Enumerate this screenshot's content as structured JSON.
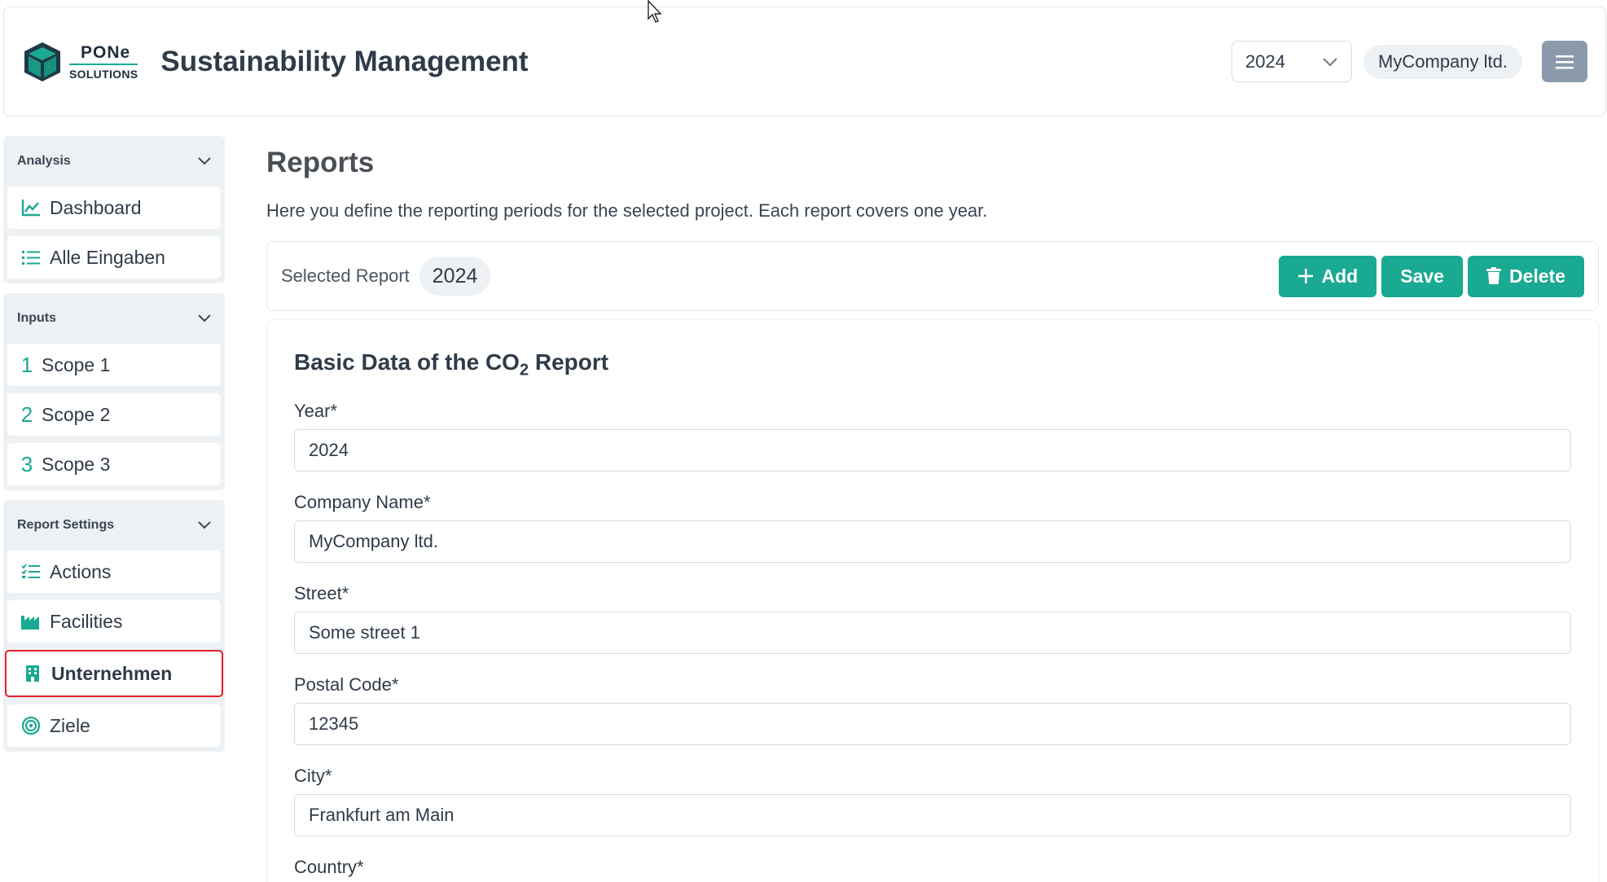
{
  "header": {
    "logo_top": "PONe",
    "logo_bottom": "SOLUTIONS",
    "title": "Sustainability Management",
    "year": "2024",
    "company": "MyCompany ltd."
  },
  "sidebar": {
    "groups": [
      {
        "title": "Analysis",
        "items": [
          {
            "label": "Dashboard",
            "icon": "chart-line-icon"
          },
          {
            "label": "Alle Eingaben",
            "icon": "list-icon"
          }
        ]
      },
      {
        "title": "Inputs",
        "items": [
          {
            "num": "1",
            "label": "Scope 1"
          },
          {
            "num": "2",
            "label": "Scope 2"
          },
          {
            "num": "3",
            "label": "Scope 3"
          }
        ]
      },
      {
        "title": "Report Settings",
        "items": [
          {
            "label": "Actions",
            "icon": "checklist-icon"
          },
          {
            "label": "Facilities",
            "icon": "factory-icon"
          },
          {
            "label": "Unternehmen",
            "icon": "building-icon",
            "active": true
          },
          {
            "label": "Ziele",
            "icon": "target-icon"
          }
        ]
      }
    ]
  },
  "main": {
    "title": "Reports",
    "description": "Here you define the reporting periods for the selected project. Each report covers one year.",
    "selected_label": "Selected Report",
    "selected_year": "2024",
    "buttons": {
      "add": "Add",
      "save": "Save",
      "delete": "Delete"
    },
    "form": {
      "title_prefix": "Basic Data of the CO",
      "title_sub": "2",
      "title_suffix": " Report",
      "fields": [
        {
          "label": "Year*",
          "value": "2024"
        },
        {
          "label": "Company Name*",
          "value": "MyCompany ltd."
        },
        {
          "label": "Street*",
          "value": "Some street 1"
        },
        {
          "label": "Postal Code*",
          "value": "12345"
        },
        {
          "label": "City*",
          "value": "Frankfurt am Main"
        },
        {
          "label": "Country*",
          "value": ""
        }
      ]
    }
  },
  "colors": {
    "accent": "#1aa992",
    "active_outline": "#e0202b",
    "menu_button": "#8b9aab"
  }
}
